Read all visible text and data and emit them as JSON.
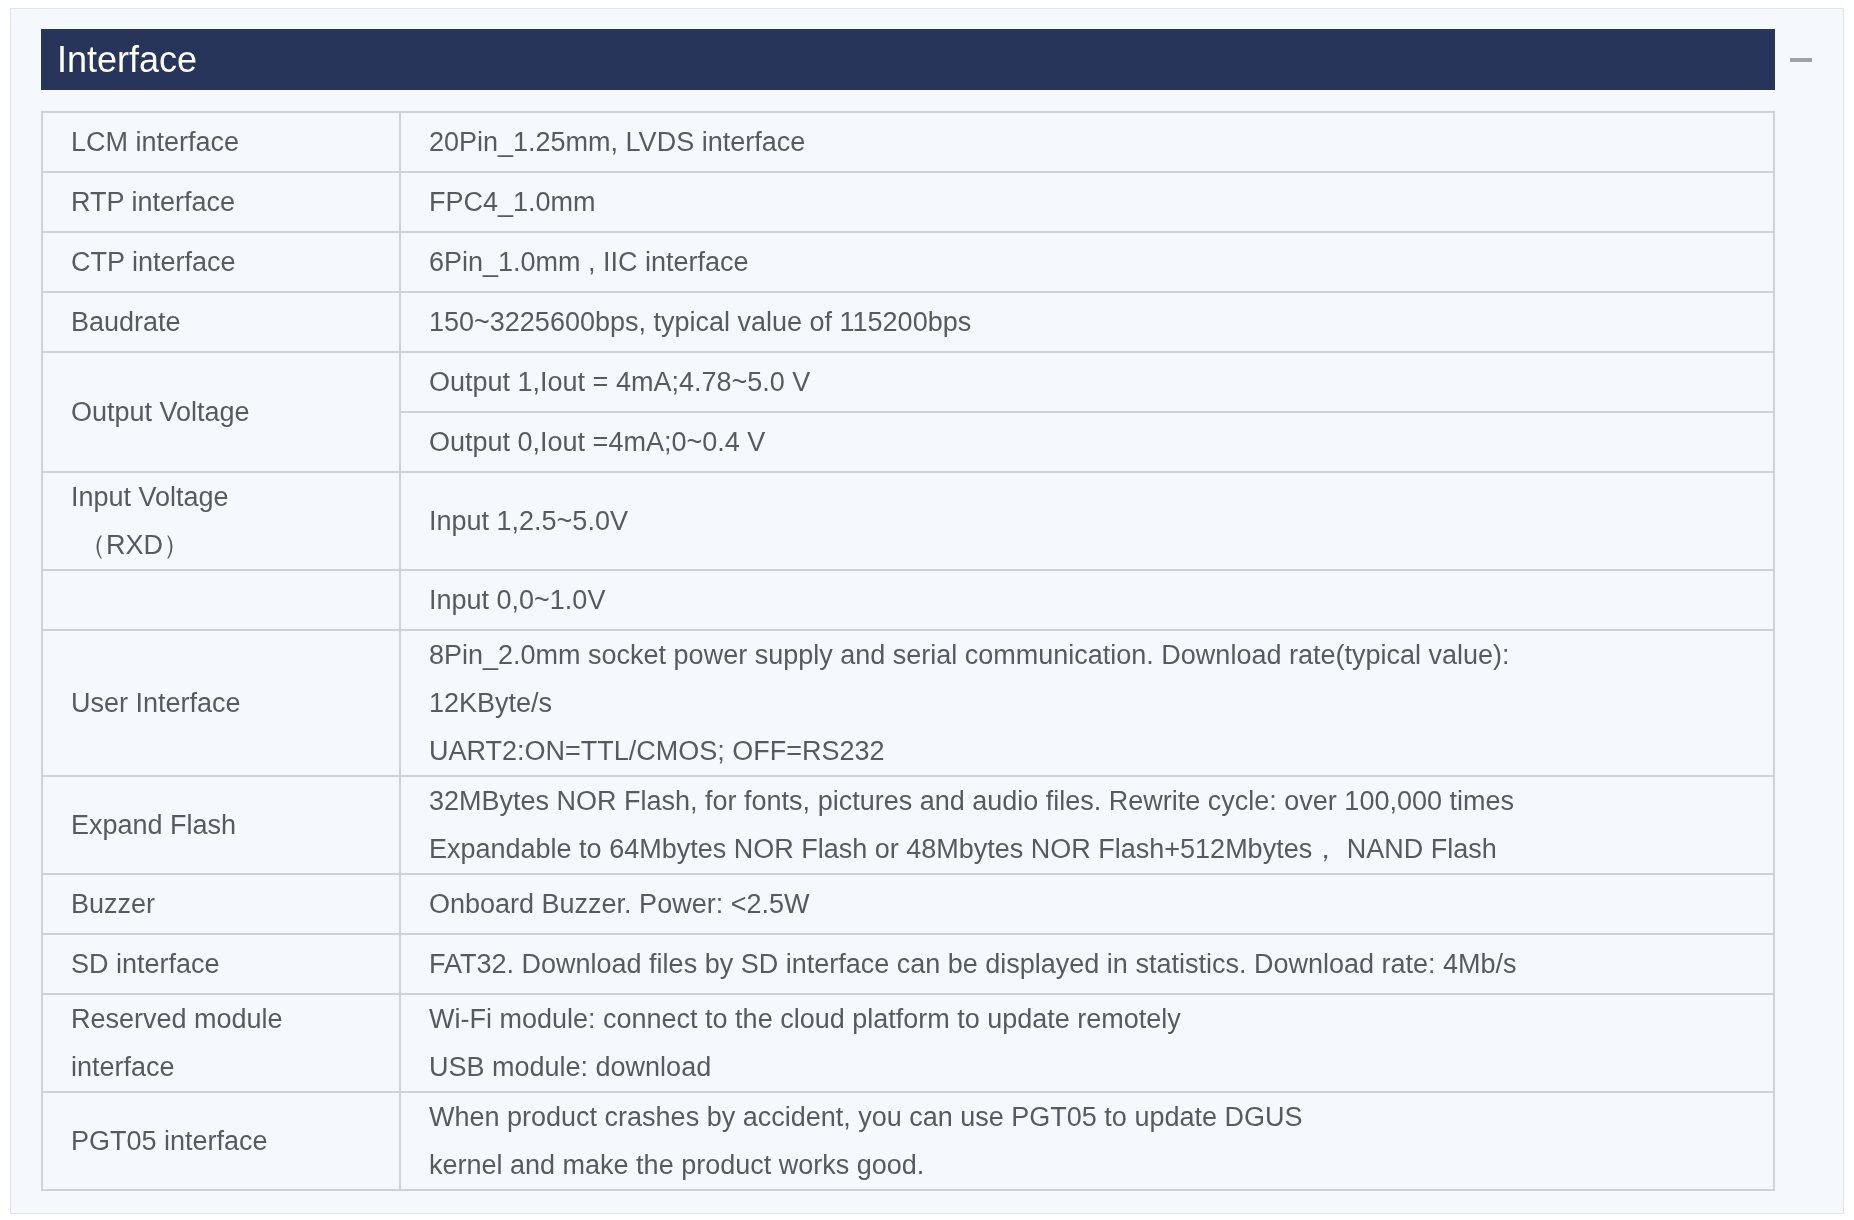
{
  "section": {
    "title": "Interface",
    "expanded": true
  },
  "rows": [
    {
      "label": [
        "LCM interface"
      ],
      "values": [
        [
          "20Pin_1.25mm, LVDS interface"
        ]
      ]
    },
    {
      "label": [
        "RTP interface"
      ],
      "values": [
        [
          "FPC4_1.0mm"
        ]
      ]
    },
    {
      "label": [
        "CTP interface"
      ],
      "values": [
        [
          "6Pin_1.0mm , IIC interface"
        ]
      ]
    },
    {
      "label": [
        "Baudrate"
      ],
      "values": [
        [
          "150~3225600bps, typical value of 115200bps"
        ]
      ]
    },
    {
      "label": [
        "Output Voltage"
      ],
      "values": [
        [
          "Output 1,Iout = 4mA;4.78~5.0 V"
        ],
        [
          "Output 0,Iout =4mA;0~0.4 V"
        ]
      ]
    },
    {
      "label": [
        "Input Voltage",
        "（RXD）"
      ],
      "values": [
        [
          "Input 1,2.5~5.0V"
        ]
      ]
    },
    {
      "values": [
        [
          "Input 0,0~1.0V"
        ]
      ]
    },
    {
      "label": [
        "User Interface"
      ],
      "values": [
        [
          "8Pin_2.0mm socket power supply and serial communication. Download rate(typical value):",
          "12KByte/s",
          "UART2:ON=TTL/CMOS; OFF=RS232"
        ]
      ]
    },
    {
      "label": [
        "Expand Flash"
      ],
      "values": [
        [
          "32MBytes NOR Flash, for fonts, pictures and audio files. Rewrite cycle: over 100,000 times",
          "Expandable to 64Mbytes NOR Flash or 48Mbytes NOR Flash+512Mbytes，  NAND Flash"
        ]
      ]
    },
    {
      "label": [
        "Buzzer"
      ],
      "values": [
        [
          "Onboard Buzzer. Power: <2.5W"
        ]
      ]
    },
    {
      "label": [
        "SD interface"
      ],
      "values": [
        [
          "FAT32. Download files by SD interface can be displayed in statistics. Download rate: 4Mb/s"
        ]
      ]
    },
    {
      "label": [
        "Reserved module",
        "interface"
      ],
      "values": [
        [
          "Wi-Fi module: connect to the cloud platform to update remotely",
          "USB module: download"
        ]
      ]
    },
    {
      "label": [
        "PGT05 interface"
      ],
      "values": [
        [
          "When product crashes by accident, you can use PGT05 to update DGUS",
          "kernel and make the product works good."
        ]
      ]
    }
  ]
}
